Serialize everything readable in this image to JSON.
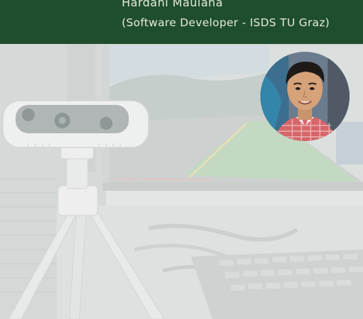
{
  "header": {
    "name": "Hardani Maulana",
    "role": "(Software Developer - ISDS TU Graz)"
  },
  "colors": {
    "header_bg": "#1f4e2e",
    "header_text": "#e6ecd8",
    "photo_wash": "#e9ecea"
  },
  "icons": {
    "camera": "depth-camera-icon",
    "avatar": "person-portrait-icon"
  }
}
